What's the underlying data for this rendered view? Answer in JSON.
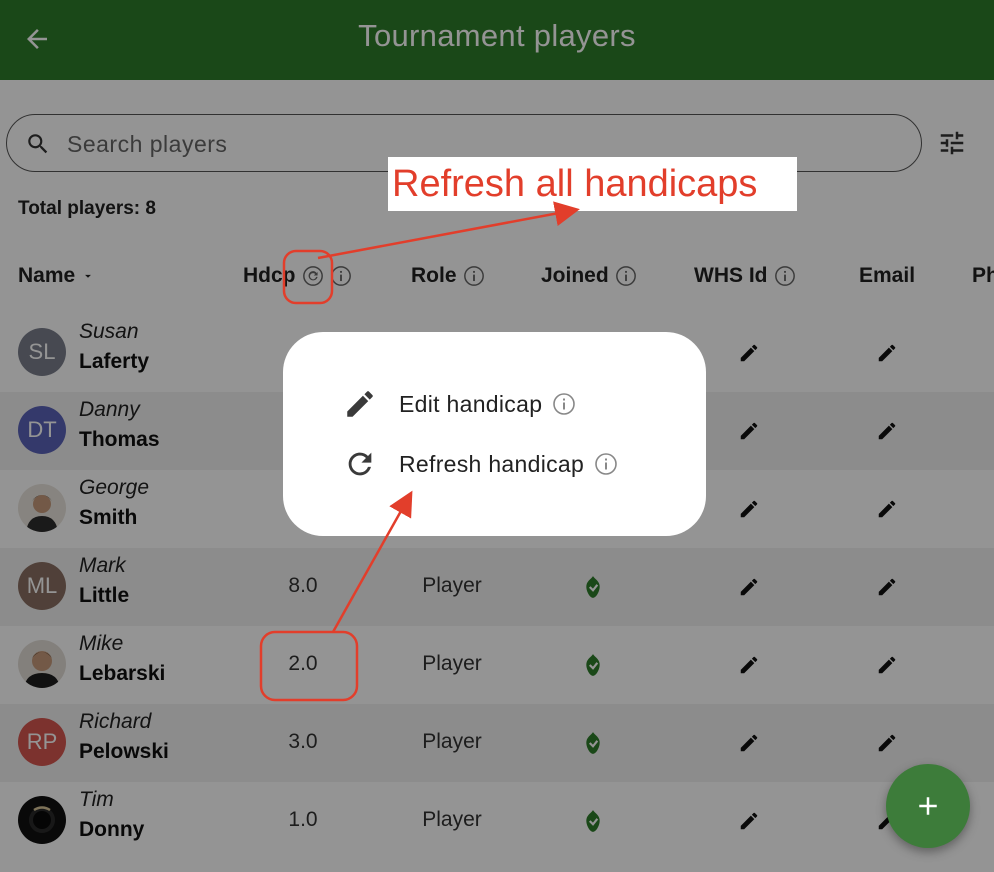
{
  "appbar": {
    "title": "Tournament players",
    "back_icon": "arrow-back-icon"
  },
  "search": {
    "placeholder": "Search players",
    "icon": "search-icon"
  },
  "filter": {
    "icon": "tune-icon"
  },
  "total_label": "Total players: 8",
  "columns": {
    "name": "Name",
    "hdcp": "Hdcp",
    "role": "Role",
    "joined": "Joined",
    "whs": "WHS Id",
    "email": "Email",
    "phone": "Ph"
  },
  "players": [
    {
      "first": "Susan",
      "last": "Laferty",
      "initials": "SL",
      "avatar_color": "#7a7f8c",
      "hdcp": "",
      "role": "",
      "joined": false
    },
    {
      "first": "Danny",
      "last": "Thomas",
      "initials": "DT",
      "avatar_color": "#5b63b8",
      "hdcp": "",
      "role": "",
      "joined": false
    },
    {
      "first": "George",
      "last": "Smith",
      "initials": "",
      "avatar_color": "#c9b9a4",
      "hdcp": "",
      "role": "",
      "joined": false
    },
    {
      "first": "Mark",
      "last": "Little",
      "initials": "ML",
      "avatar_color": "#8a6f62",
      "hdcp": "8.0",
      "role": "Player",
      "joined": true
    },
    {
      "first": "Mike",
      "last": "Lebarski",
      "initials": "",
      "avatar_color": "#c69a7a",
      "hdcp": "2.0",
      "role": "Player",
      "joined": true
    },
    {
      "first": "Richard",
      "last": "Pelowski",
      "initials": "RP",
      "avatar_color": "#d65650",
      "hdcp": "3.0",
      "role": "Player",
      "joined": true
    },
    {
      "first": "Tim",
      "last": "Donny",
      "initials": "",
      "avatar_color": "#111111",
      "hdcp": "1.0",
      "role": "Player",
      "joined": true
    }
  ],
  "menu": {
    "edit_label": "Edit handicap",
    "refresh_label": "Refresh handicap"
  },
  "fab": {
    "icon": "plus-icon"
  },
  "annotation": {
    "callout": "Refresh all handicaps",
    "color": "#e23e2b"
  },
  "colors": {
    "appbar": "#2e7d2a",
    "accent_green": "#2e7d2a"
  }
}
